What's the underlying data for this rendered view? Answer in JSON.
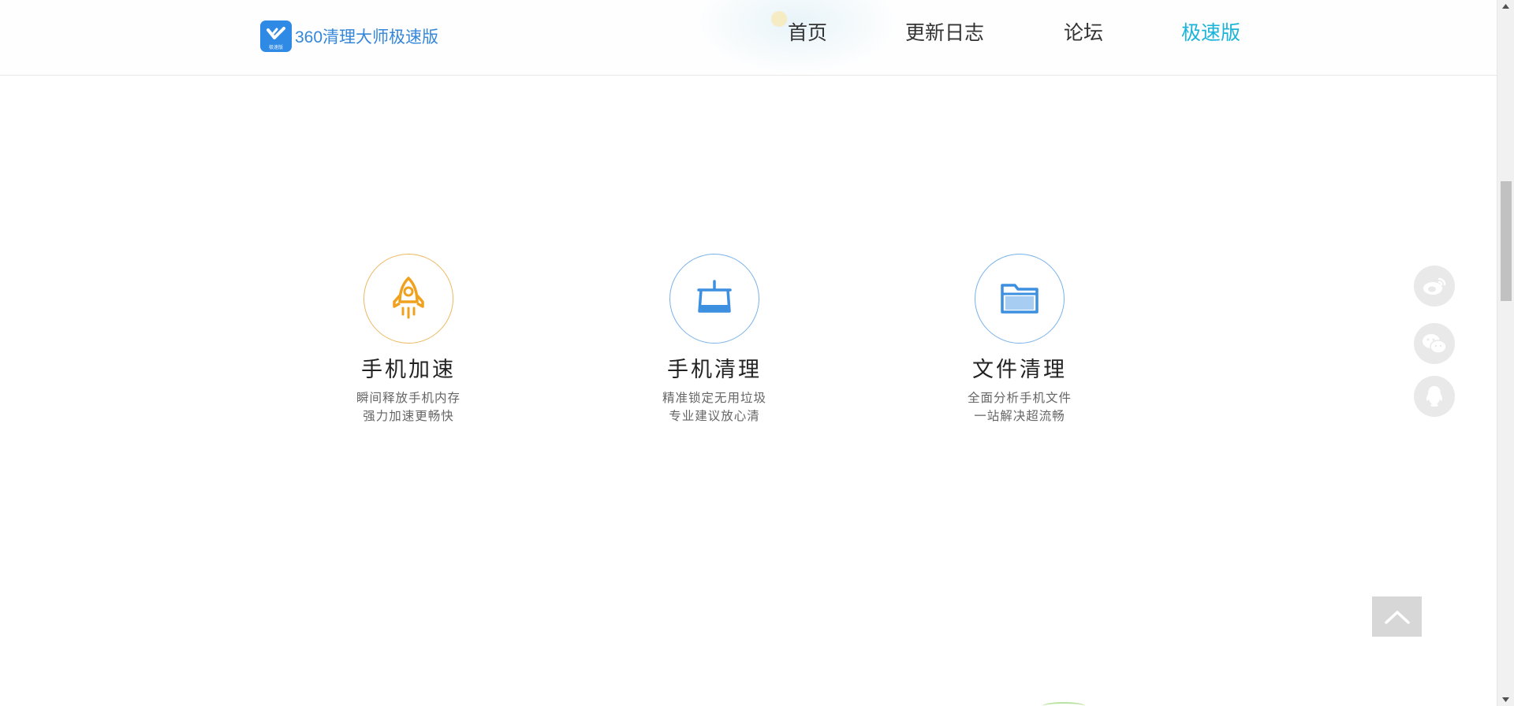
{
  "header": {
    "logo_text": "360清理大师极速版",
    "logo_badge_text": "极速版",
    "nav": [
      {
        "label": "首页",
        "active": false
      },
      {
        "label": "更新日志",
        "active": false
      },
      {
        "label": "论坛",
        "active": false
      },
      {
        "label": "极速版",
        "active": true
      }
    ],
    "accent_color": "#1bb3d9"
  },
  "features": [
    {
      "icon": "rocket-icon",
      "title": "手机加速",
      "desc_line1": "瞬间释放手机内存",
      "desc_line2": "强力加速更畅快",
      "color": "#f0a21f"
    },
    {
      "icon": "broom-icon",
      "title": "手机清理",
      "desc_line1": "精准锁定无用垃圾",
      "desc_line2": "专业建议放心清",
      "color": "#3d8fe0"
    },
    {
      "icon": "folder-icon",
      "title": "文件清理",
      "desc_line1": "全面分析手机文件",
      "desc_line2": "一站解决超流畅",
      "color": "#3d8fe0"
    }
  ],
  "side_buttons": [
    "weibo-icon",
    "wechat-icon",
    "qq-icon"
  ],
  "back_to_top_icon": "chevron-up-icon"
}
